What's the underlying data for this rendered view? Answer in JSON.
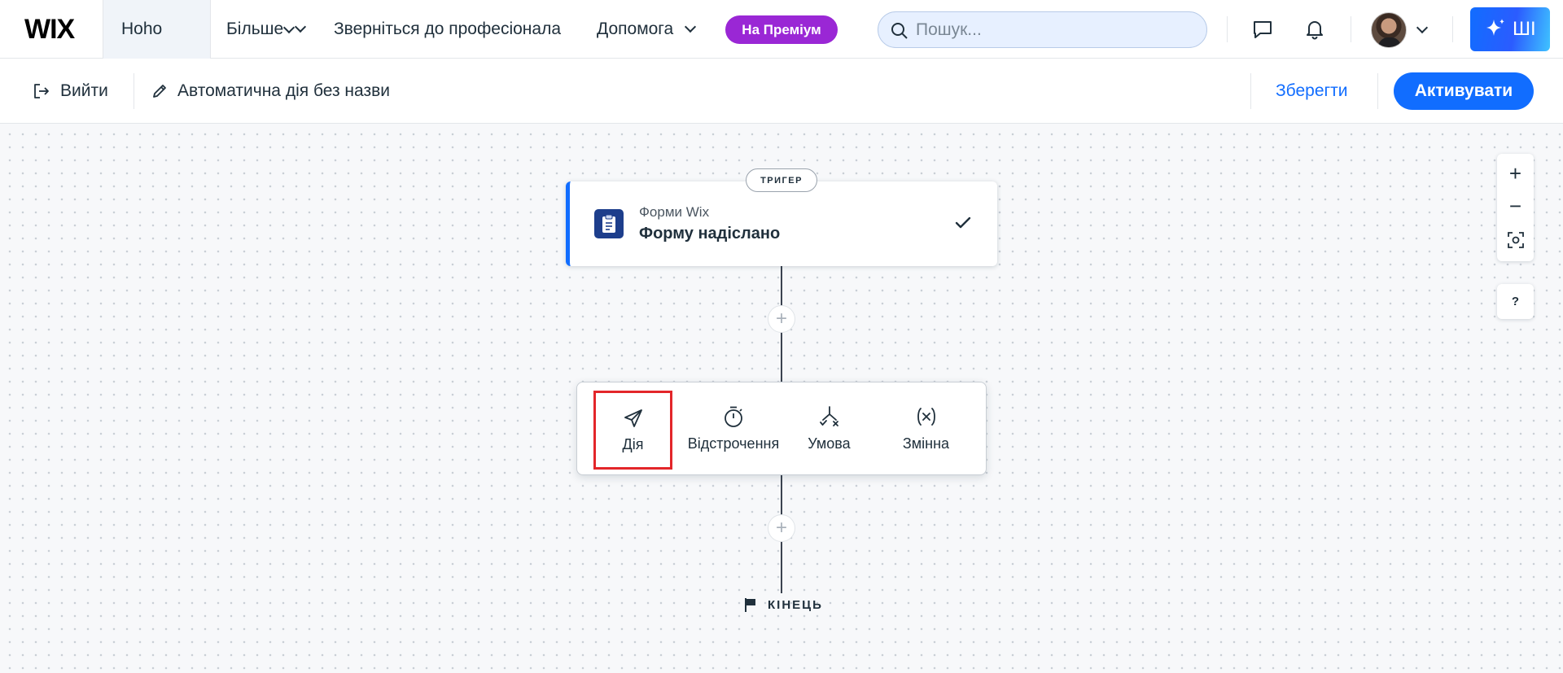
{
  "topbar": {
    "logo": "WIX",
    "site_name": "Hoho",
    "nav": {
      "more": "Більше",
      "hire_pro": "Зверніться до професіонала",
      "help": "Допомога"
    },
    "premium_label": "На Преміум",
    "search_placeholder": "Пошук...",
    "ai_label": "ШІ"
  },
  "actionbar": {
    "exit_label": "Вийти",
    "automation_title": "Автоматична дія без назви",
    "save_label": "Зберегти",
    "activate_label": "Активувати"
  },
  "flow": {
    "trigger_badge": "ТРИГЕР",
    "trigger_app": "Форми Wix",
    "trigger_title": "Форму надіслано",
    "step_options": [
      {
        "label": "Дія",
        "icon": "send-icon",
        "highlighted": true
      },
      {
        "label": "Відстрочення",
        "icon": "timer-icon",
        "highlighted": false
      },
      {
        "label": "Умова",
        "icon": "branch-icon",
        "highlighted": false
      },
      {
        "label": "Змінна",
        "icon": "variable-icon",
        "highlighted": false
      }
    ],
    "end_label": "КІНЕЦЬ"
  },
  "zoom": {
    "zoom_in": "+",
    "zoom_out": "−",
    "help": "?"
  },
  "colors": {
    "accent": "#116dff",
    "premium": "#9a27d5",
    "highlight_box": "#e3262a",
    "forms_icon_bg": "#1d3e8c"
  }
}
